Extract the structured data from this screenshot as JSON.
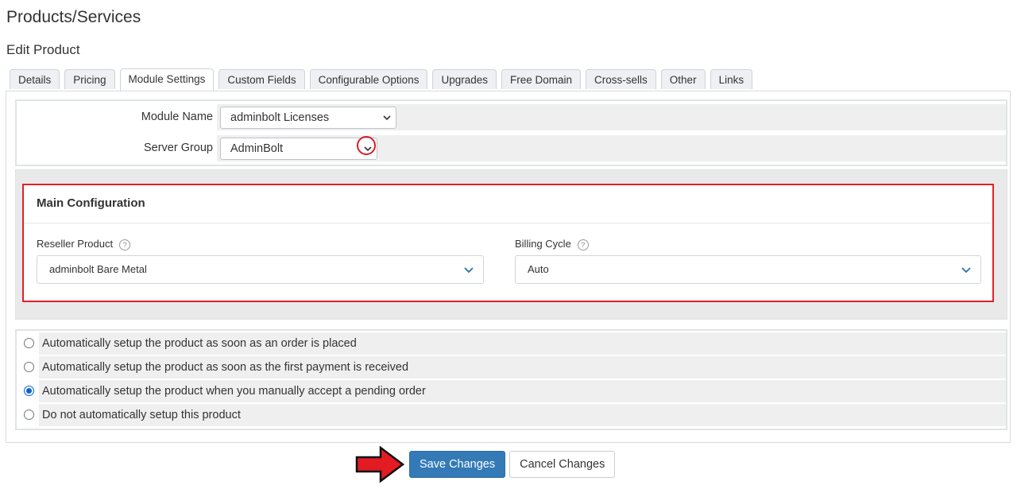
{
  "page": {
    "title": "Products/Services",
    "subtitle": "Edit Product"
  },
  "tabs": [
    {
      "label": "Details"
    },
    {
      "label": "Pricing"
    },
    {
      "label": "Module Settings",
      "active": true
    },
    {
      "label": "Custom Fields"
    },
    {
      "label": "Configurable Options"
    },
    {
      "label": "Upgrades"
    },
    {
      "label": "Free Domain"
    },
    {
      "label": "Cross-sells"
    },
    {
      "label": "Other"
    },
    {
      "label": "Links"
    }
  ],
  "form": {
    "module_name_label": "Module Name",
    "module_name_value": "adminbolt Licenses",
    "server_group_label": "Server Group",
    "server_group_value": "AdminBolt"
  },
  "main_config": {
    "heading": "Main Configuration",
    "reseller_product_label": "Reseller Product",
    "reseller_product_value": "adminbolt Bare Metal",
    "billing_cycle_label": "Billing Cycle",
    "billing_cycle_value": "Auto"
  },
  "setup_options": [
    {
      "label": "Automatically setup the product as soon as an order is placed",
      "selected": false
    },
    {
      "label": "Automatically setup the product as soon as the first payment is received",
      "selected": false
    },
    {
      "label": "Automatically setup the product when you manually accept a pending order",
      "selected": true
    },
    {
      "label": "Do not automatically setup this product",
      "selected": false
    }
  ],
  "buttons": {
    "save": "Save Changes",
    "cancel": "Cancel Changes"
  },
  "colors": {
    "highlight": "#e2202b",
    "primary": "#337ab7",
    "radio_selected": "#0b63ce"
  },
  "icons": {
    "help": "question-circle-icon",
    "chevron": "chevron-down-icon",
    "arrow": "right-arrow-icon"
  }
}
